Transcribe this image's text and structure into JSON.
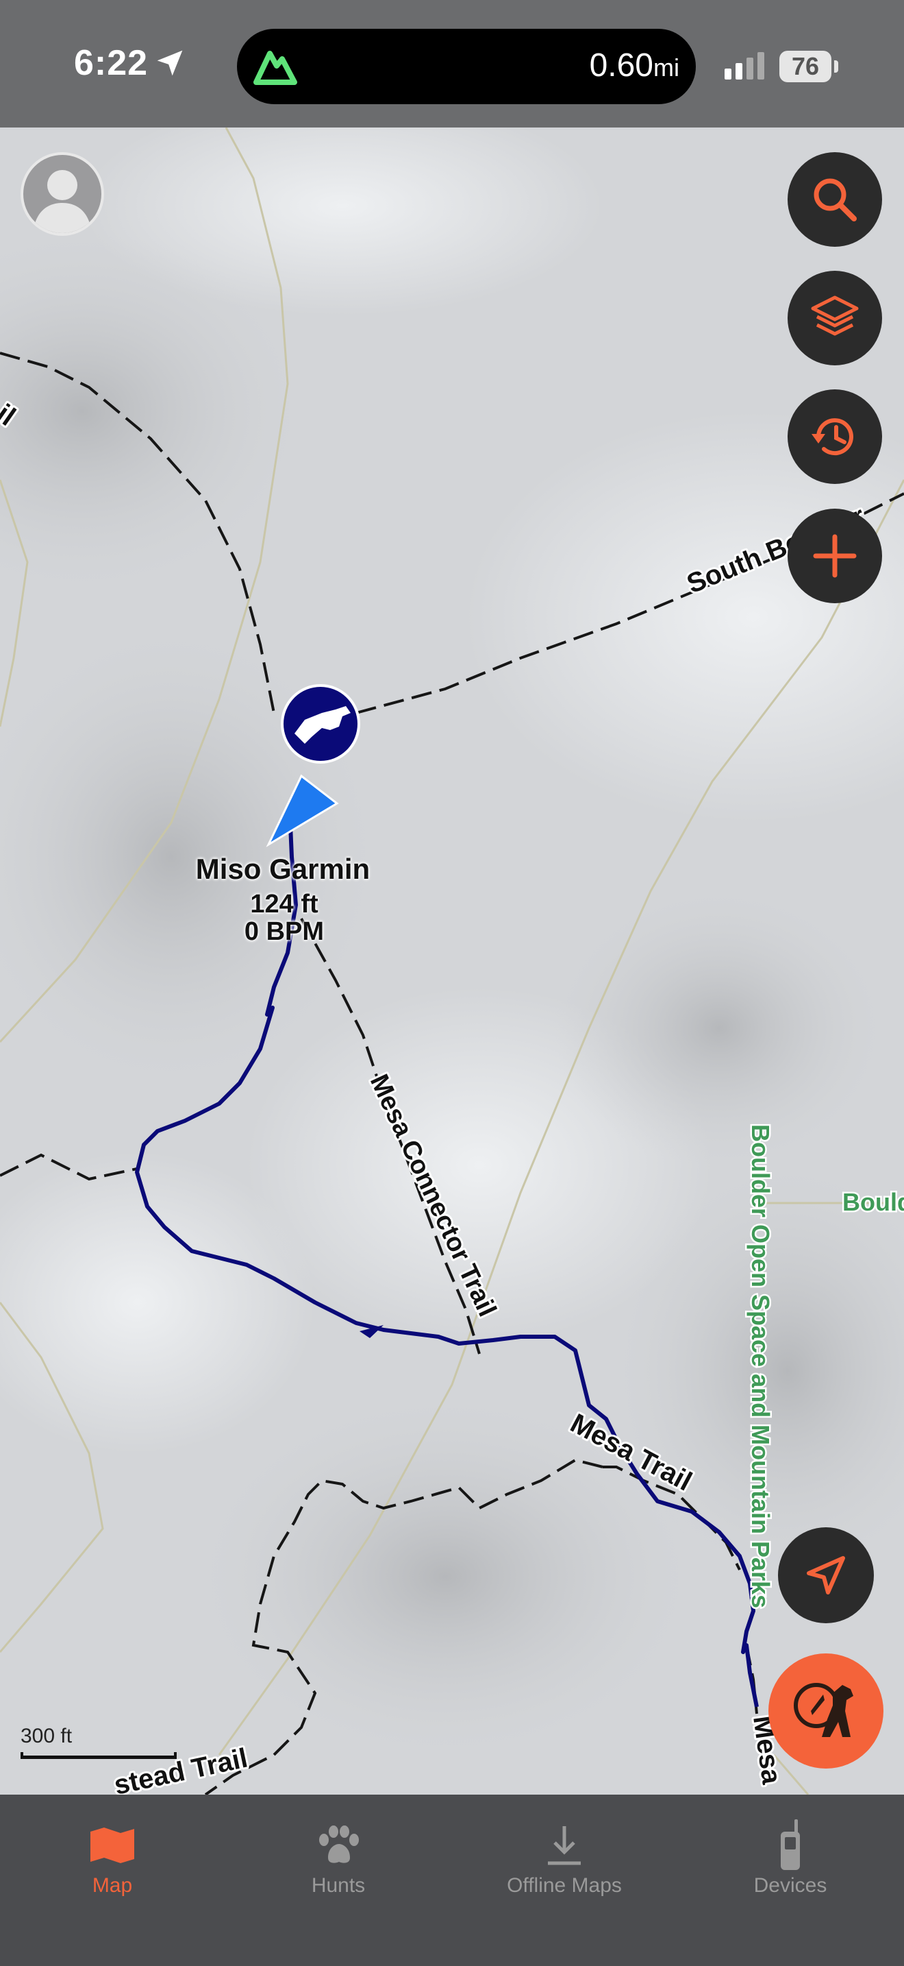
{
  "status_bar": {
    "time": "6:22",
    "activity_distance": "0.60",
    "distance_unit": "mi",
    "battery": "76"
  },
  "map": {
    "marker": {
      "name": "Miso Garmin",
      "distance": "124 ft",
      "heart_rate": "0 BPM"
    },
    "labels": {
      "south_boulder": "South Boulder",
      "mesa_connector": "Mesa Connector Trail",
      "mesa_trail": "Mesa Trail",
      "mesa_short": "Mesa",
      "boulder_osmp": "Boulder Open Space and Mountain Parks",
      "boulder_right": "Bould",
      "homestead": "stead Trail",
      "left_edge": "il"
    },
    "scale_label": "300 ft"
  },
  "tabs": [
    {
      "label": "Map",
      "icon": "map-icon",
      "active": true
    },
    {
      "label": "Hunts",
      "icon": "paw-icon",
      "active": false
    },
    {
      "label": "Offline Maps",
      "icon": "download-icon",
      "active": false
    },
    {
      "label": "Devices",
      "icon": "device-icon",
      "active": false
    }
  ],
  "colors": {
    "accent": "#f4633a",
    "track": "#0a0a78",
    "park_label": "#3f9a57"
  }
}
